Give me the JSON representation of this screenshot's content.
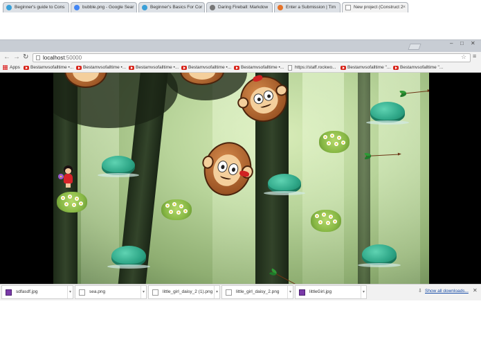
{
  "browser": {
    "tabs": [
      {
        "label": "Beginner's guide to Cons",
        "favicon_color": "#3aa0d8"
      },
      {
        "label": "bubble.png - Google Sear",
        "favicon_color": "#4285f4"
      },
      {
        "label": "Beginner's Basics For Cor",
        "favicon_color": "#3aa0d8"
      },
      {
        "label": "Daring Fireball: Markdow",
        "favicon_color": "#777777"
      },
      {
        "label": "Enter a Submission | Tim",
        "favicon_color": "#e5732a"
      },
      {
        "label": "New project (Construct 2",
        "favicon_color": "#444444",
        "active": true
      }
    ],
    "window": {
      "minimize": "–",
      "maximize": "□",
      "close": "✕"
    },
    "nav": {
      "back": "←",
      "forward": "→",
      "reload": "↻"
    },
    "url": {
      "host": "localhost",
      "port": ":50000"
    },
    "star_icon": "☆",
    "menu_icon": "≡",
    "bookmarks": [
      {
        "label": "Apps",
        "icon": "apps-icon"
      },
      {
        "label": "Bestamvsofalltime •...",
        "icon": "youtube-icon"
      },
      {
        "label": "Bestamvsofalltime •...",
        "icon": "youtube-icon"
      },
      {
        "label": "Bestamvsofalltime •...",
        "icon": "youtube-icon"
      },
      {
        "label": "Bestamvsofalltime •...",
        "icon": "youtube-icon"
      },
      {
        "label": "Bestamvsofalltime •...",
        "icon": "youtube-icon"
      },
      {
        "label": "https://staff.rockwo...",
        "icon": "page-icon"
      },
      {
        "label": "Bestamvsofalltime \"...",
        "icon": "youtube-icon"
      },
      {
        "label": "Bestamvsofalltime \"...",
        "icon": "youtube-icon"
      }
    ]
  },
  "downloads": {
    "items": [
      {
        "label": "sdfasdf.jpg",
        "icon": "image-file-icon"
      },
      {
        "label": "sea.png",
        "icon": "document-file-icon"
      },
      {
        "label": "little_girl_daisy_2 (1).png",
        "icon": "document-file-icon"
      },
      {
        "label": "little_girl_daisy_2.png",
        "icon": "document-file-icon"
      },
      {
        "label": "littleGirl.jpg",
        "icon": "image-file-icon"
      }
    ],
    "show_all": "Show all downloads...",
    "close": "✕",
    "dropdown": "▾"
  },
  "colors": {
    "bush": "#2fa788",
    "daisy": "#88b845",
    "monkey": "#9b5424",
    "girl_dress": "#d8242a",
    "arrow": "#6b3414"
  }
}
